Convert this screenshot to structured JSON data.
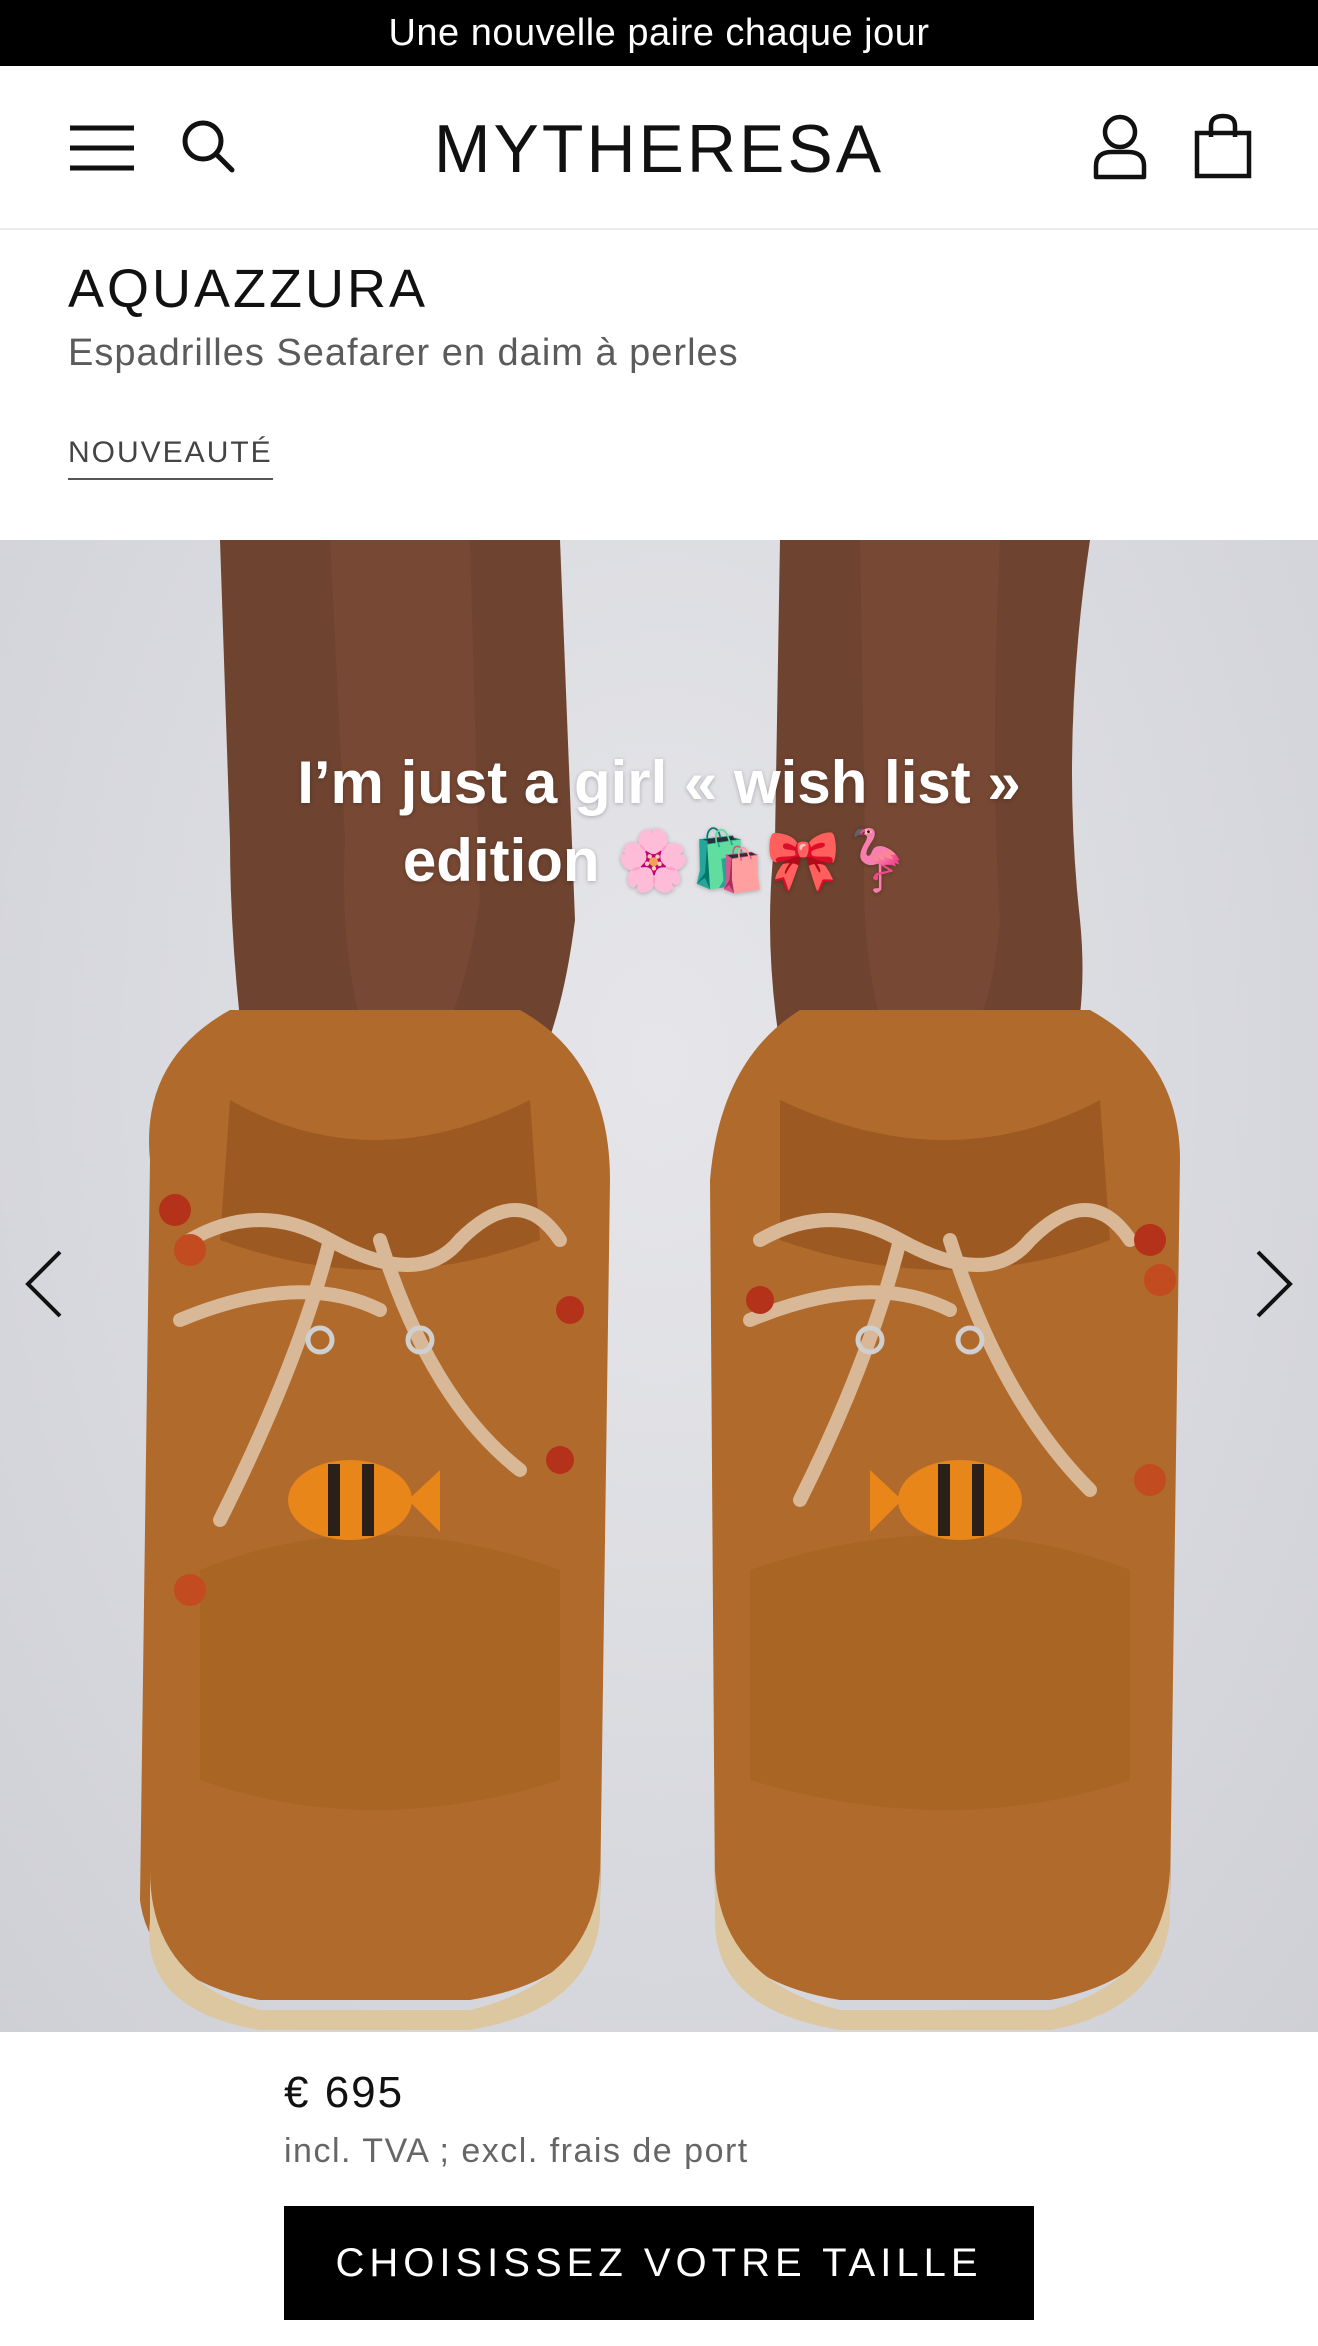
{
  "promo": {
    "text": "Une nouvelle paire chaque jour"
  },
  "header": {
    "logo": "MYTHERESA",
    "icons": {
      "menu": "menu-icon",
      "search": "search-icon",
      "account": "user-icon",
      "bag": "shopping-bag-icon"
    }
  },
  "product": {
    "brand": "AQUAZZURA",
    "name": "Espadrilles Seafarer en daim à perles",
    "badge": "NOUVEAUTÉ"
  },
  "gallery": {
    "caption_line1": "I’m just a girl « wish list »",
    "caption_line2": "edition 🌸🛍️🎀🦩",
    "icons": {
      "prev": "chevron-left-icon",
      "next": "chevron-right-icon"
    }
  },
  "pricing": {
    "price": "€ 695",
    "note": "incl. TVA ; excl. frais de port"
  },
  "cta": {
    "label": "CHOISISSEZ VOTRE TAILLE"
  },
  "colors": {
    "black": "#000000",
    "suede": "#b06a2c",
    "background": "#ffffff",
    "muted_text": "#666666"
  }
}
